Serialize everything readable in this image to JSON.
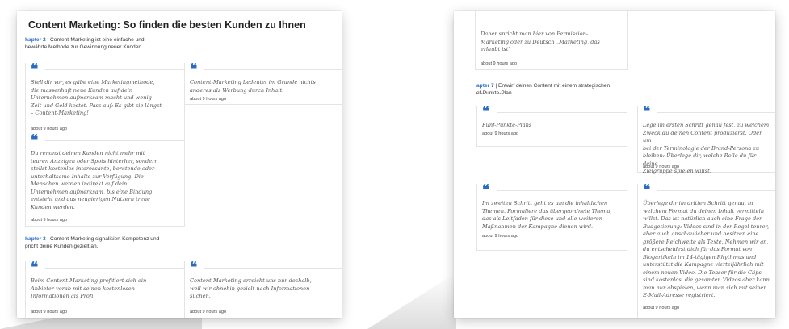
{
  "left_page": {
    "title": "Content Marketing: So finden die besten Kunden zu Ihnen",
    "chapter2": {
      "label": "hapter 2",
      "text_line1": " | Content-Marketing ist eine einfache und",
      "text_line2": "bewährte Methode zur Gewinnung neuer Kunden."
    },
    "chapter3": {
      "label": "hapter 3",
      "text_line1": " | Content-Marketing signalisiert Kompetenz und",
      "text_line2": "pricht deine Kunden gezielt an."
    },
    "cards": [
      {
        "lines": [
          "Stell dir vor, es gäbe eine Marketingmethode,",
          "die massenhaft neue Kunden auf dein",
          "Unternehmen aufmerksam macht und wenig",
          "Zeit und Geld kostet. Pass auf: Es gibt sie längst",
          "– Content-Marketing!"
        ],
        "time": "about 9 hours ago"
      },
      {
        "lines": [
          "Content-Marketing bedeutet im Grunde nichts",
          "anderes als Werbung durch Inhalt."
        ],
        "time": "about 9 hours ago"
      },
      {
        "lines": [
          "Du renonst deinen Kunden nicht mehr mit",
          "teuren Anzeigen oder Spots hinterher, sondern",
          "stellst kostenlos interessante, beratende oder",
          "unterhaltsame Inhalte zur Verfügung. Die",
          "Menschen werden indirekt auf dein",
          "Unternehmen aufmerksam, bis eine Bindung",
          "entsteht und aus neugierigen Nutzern treue",
          "Kunden werden."
        ],
        "time": "about 9 hours ago"
      },
      {
        "lines": [
          "Beim Content-Marketing profitiert sich ein",
          "Anbieter vorab mit seinen kostenlosen",
          "Informationen als Profi."
        ],
        "time": "about 9 hours ago"
      },
      {
        "lines": [
          "Content-Marketing erreicht uns nur deshalb,",
          "weil wir ohnehin gezielt nach Informationen",
          "suchen."
        ],
        "time": "about 9 hours ago"
      }
    ]
  },
  "right_page": {
    "chapter7": {
      "label": "apter 7",
      "text_line1": " | Entwirf deinen Content mit einem strategischen",
      "text_line2": "ef-Punkte-Plan."
    },
    "cards": [
      {
        "lines": [
          "Daher spricht man hier von Permission-",
          "Marketing oder zu Deutsch „Marketing, das",
          "erlaubt ist\""
        ],
        "time": "about 9 hours ago"
      },
      {
        "lines": [
          "Fünf-Punkte-Plans"
        ],
        "time": "about 9 hours ago"
      },
      {
        "lines": [
          "Lege im ersten Schritt genau fest, zu welchem",
          "Zweck du deinen Content produzierst. Oder um",
          "bei der Terminologie der Brand-Persona zu",
          "bleiben: Überlege dir, welche Rolle du für deine",
          "Zielgruppe spielen willst."
        ],
        "time": "about 9 hours ago"
      },
      {
        "lines": [
          "Im zweiten Schritt geht es um die inhaltlichen",
          "Themen. Formuliere das übergeordnete Thema,",
          "das als Leitfaden für diese und alle weiteren",
          "Maßnahmen der Kampagne dienen wird."
        ],
        "time": "about 9 hours ago"
      },
      {
        "lines": [
          "Überlege dir im dritten Schritt genau, in",
          "welchem Format du deinen Inhalt vermitteln",
          "willst. Das ist natürlich auch eine Frage der",
          "Budgetierung: Videos sind in der Regel teurer,",
          "aber auch anschaulicher und besitzen eine",
          "größere Reichweite als Texte. Nehmen wir an,",
          "du entscheidest dich für das Format von",
          "Blogartikeln im 14-tägigen Rhythmus und",
          "unterstützt die Kampagne vierteljährlich mit",
          "einem neuen Video. Die Teaser für die Clips",
          "sind kostenlos, die gesamten Videos aber kann",
          "man nur abspielen, wenn man sich mit seiner",
          "E-Mail-Adresse registriert."
        ],
        "time": "about 9 hours ago"
      }
    ]
  },
  "colors": {
    "accent": "#2a6bc4",
    "text": "#555555",
    "border": "#e4e4e4"
  }
}
